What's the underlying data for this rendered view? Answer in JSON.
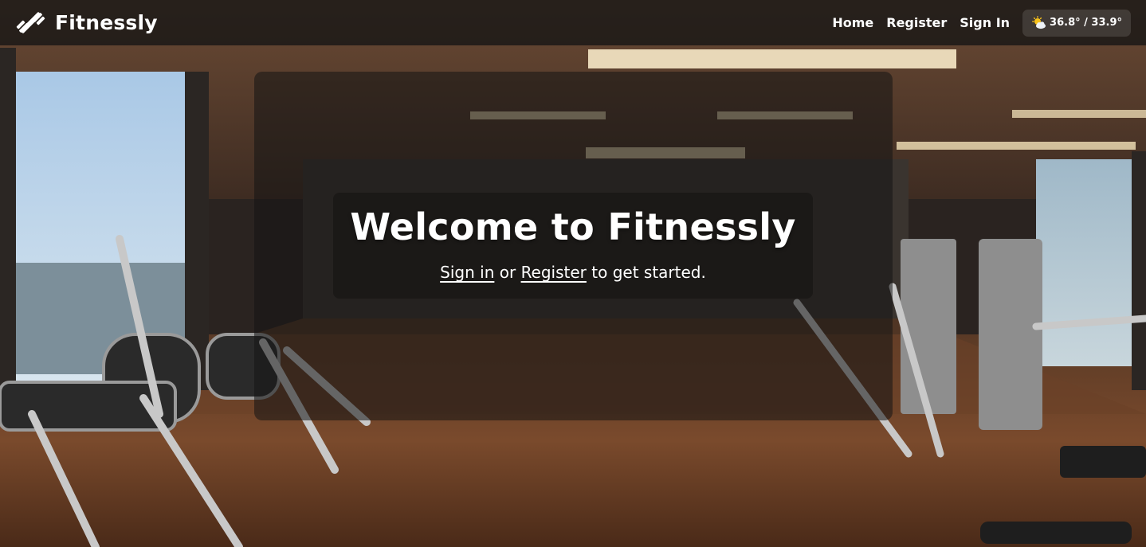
{
  "brand": {
    "name": "Fitnessly",
    "icon": "dumbbell-icon"
  },
  "nav": {
    "home": "Home",
    "register": "Register",
    "sign_in": "Sign In"
  },
  "weather": {
    "icon": "sun-behind-cloud-icon",
    "text": "36.8° / 33.9°"
  },
  "hero": {
    "title": "Welcome to Fitnessly",
    "sign_in_link": "Sign in",
    "or_text": " or ",
    "register_link": " Register",
    "suffix_text": " to get started."
  }
}
